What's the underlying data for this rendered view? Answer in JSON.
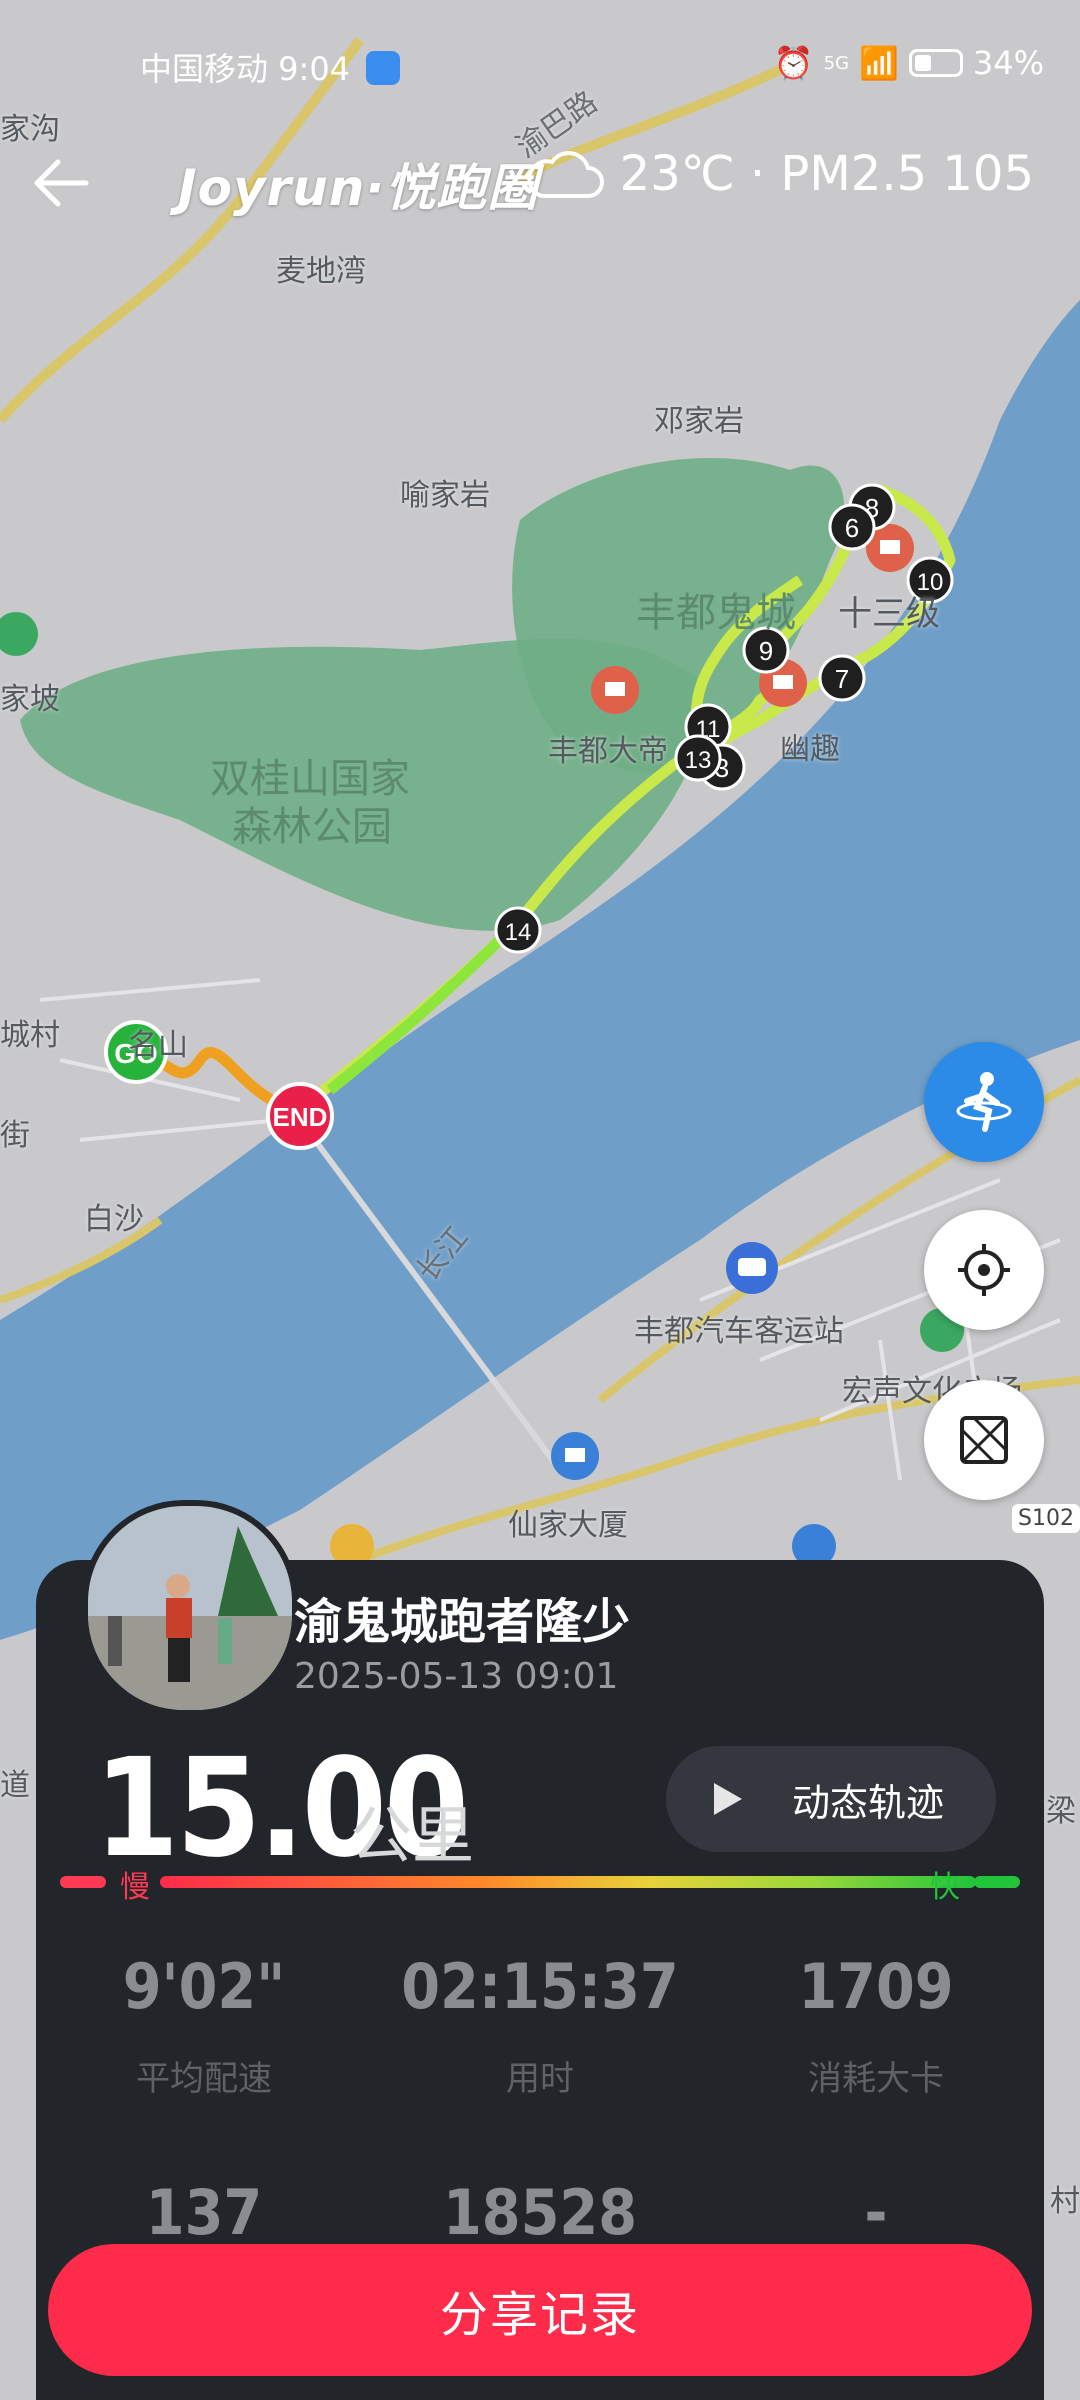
{
  "status_bar": {
    "carrier_time": "中国移动 9:04",
    "battery": "34%",
    "network": "5G"
  },
  "header": {
    "brand": "Joyrun·悦跑圈",
    "weather": "23℃ · PM2.5 105",
    "weather_icon": "cloud-icon"
  },
  "map": {
    "labels": [
      "麦地湾",
      "邓家岩",
      "喻家岩",
      "丰都鬼城",
      "十三级",
      "丰都大帝",
      "幽趣",
      "双桂山国家",
      "森林公园",
      "白沙",
      "长江",
      "丰都汽车客运站",
      "宏声文化广场",
      "仙家大厦",
      "S102",
      "家坡",
      "家沟",
      "城村",
      "渝巴路",
      "名山",
      "街",
      "道",
      "梁",
      "村"
    ],
    "markers": {
      "start": "GO",
      "end": "END",
      "waypoints": [
        "6",
        "7",
        "8",
        "9",
        "10",
        "11",
        "13",
        "3",
        "14"
      ]
    }
  },
  "record": {
    "user_name": "渝鬼城跑者隆少",
    "datetime": "2025-05-13 09:01",
    "distance": "15.00",
    "distance_unit": "公里",
    "dynamic_track_label": "动态轨迹",
    "slow_label": "慢",
    "fast_label": "快",
    "stats": [
      {
        "value": "9'02\"",
        "label": "平均配速"
      },
      {
        "value": "02:15:37",
        "label": "用时"
      },
      {
        "value": "1709",
        "label": "消耗大卡"
      },
      {
        "value": "137",
        "label": ""
      },
      {
        "value": "18528",
        "label": ""
      },
      {
        "value": "-",
        "label": ""
      }
    ],
    "share_label": "分享记录"
  },
  "colors": {
    "accent": "#ff2b4a",
    "card": "#22252a",
    "river": "#6f9fc9",
    "park": "#6fae86"
  }
}
